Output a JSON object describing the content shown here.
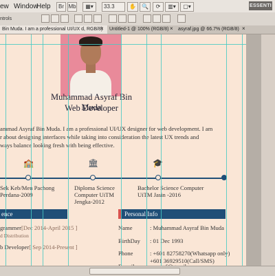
{
  "menubar": {
    "items": [
      "ew",
      "Window",
      "Help"
    ],
    "zoom": "33.3",
    "workspace": "ESSENTI"
  },
  "optionsbar": {
    "label": "ntrols"
  },
  "tabs": [
    {
      "label": "Bin Muda. I am a professional UI/UX d, RGB/8)",
      "close": "×",
      "active": true
    },
    {
      "label": "Untitled-1 @ 100% (RGB/8)",
      "close": "×",
      "active": false
    },
    {
      "label": "asyraf.jpg @ 66.7% (RGB/8)",
      "close": "×",
      "active": false
    }
  ],
  "document": {
    "name": "Muhammad Asyraf Bin Muda",
    "role": "Web Developer",
    "bio_lines": [
      "ammad Asyraf Bin Muda. I am a professional UI/UX designer for web development. I am",
      "r about designing interfaces while taking into consideration the latest UX trends and",
      "ways balance looking fresh with being effective."
    ],
    "education": [
      {
        "icon": "school-icon",
        "line1": "Sek Keb/Men Pachong",
        "line2": "Perdana-2009"
      },
      {
        "icon": "building-icon",
        "line1": "Diploma Science",
        "line2": "Computer UiTM",
        "line3": "Jengka-2012"
      },
      {
        "icon": "graduation-cap-icon",
        "line1": "Bachelor Science Computer",
        "line2": "UiTM Jasin -2016"
      }
    ],
    "experience_header": "ence",
    "experience": [
      {
        "title": "grammer",
        "date": "[Dec 2014-April 2015 ]",
        "sub": "d Distribution"
      },
      {
        "title": "b Developer",
        "date": "[ Sep 2014-Present ]",
        "sub": ""
      }
    ],
    "personal_header": "Personal Info",
    "personal": [
      {
        "label": "Name",
        "value": ":  Muhammad Asyraf Bin Muda",
        "value2": ""
      },
      {
        "label": "BirthDay",
        "value": ":  01 Dec 1993",
        "value2": ""
      },
      {
        "label": "Phone",
        "value": ":  +601 82758270(Whatsapp only)",
        "value2": "   +601 36929510(Call/SMS)"
      },
      {
        "label": "E-mail",
        "value": ":  asyraf@gmail.com",
        "value2": ""
      }
    ]
  },
  "colors": {
    "canvas": "#fae6d6",
    "accent_blue": "#1f4e77",
    "accent_red": "#d9534f",
    "guide": "#47c9c3"
  }
}
